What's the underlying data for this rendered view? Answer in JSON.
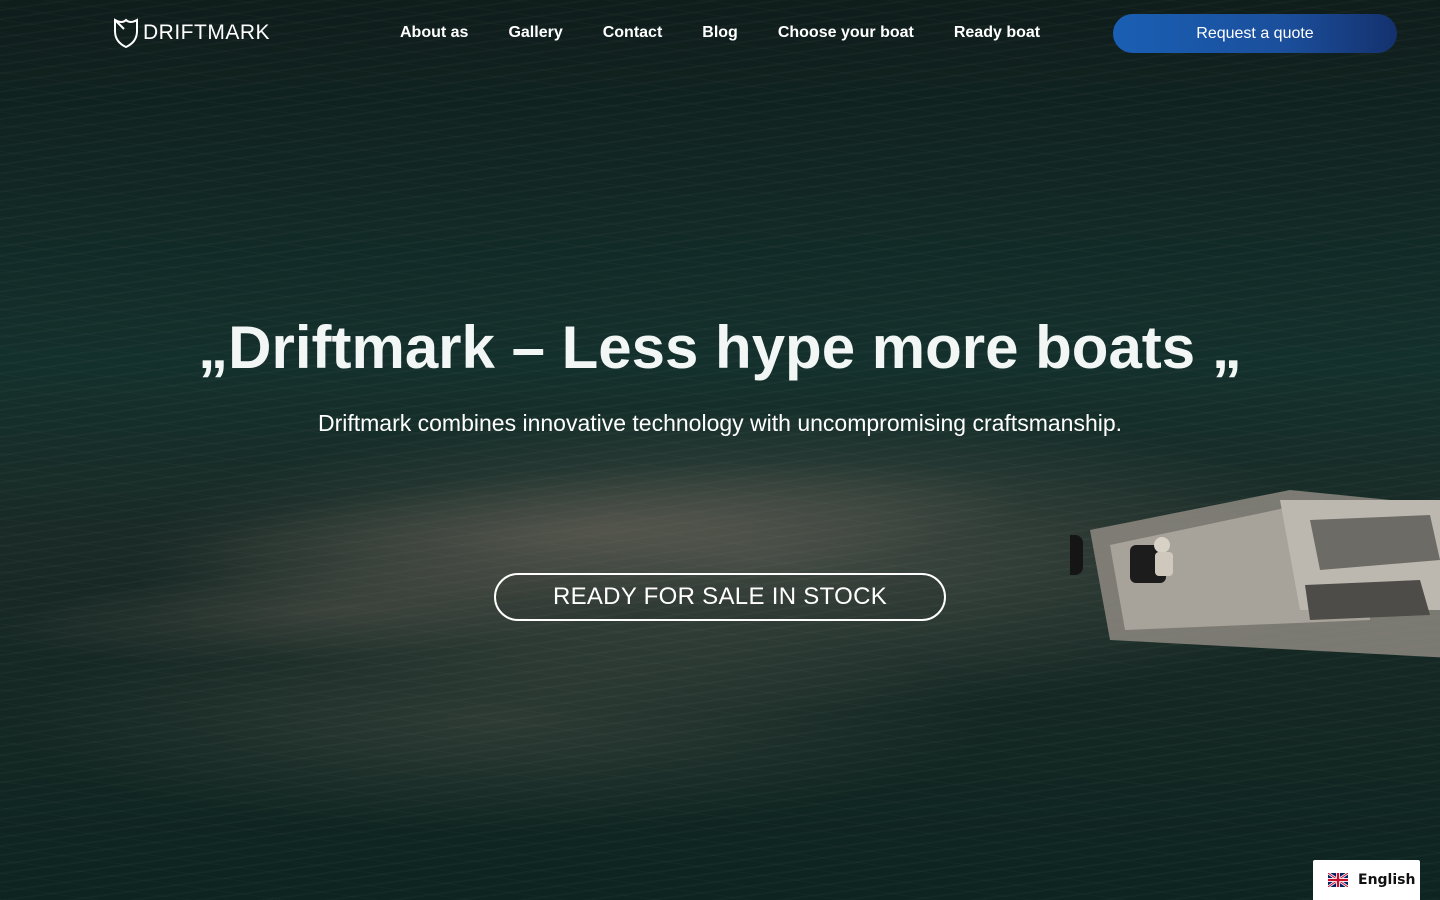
{
  "brand": {
    "name": "DRIFTMARK",
    "logo_icon": "shield-logo-icon"
  },
  "nav": {
    "items": [
      {
        "label": "About as"
      },
      {
        "label": "Gallery"
      },
      {
        "label": "Contact"
      },
      {
        "label": "Blog"
      },
      {
        "label": "Choose your boat"
      },
      {
        "label": "Ready boat"
      }
    ]
  },
  "header": {
    "quote_label": "Request a quote"
  },
  "hero": {
    "headline": "„Driftmark – Less hype more boats „",
    "subtitle": "Driftmark combines innovative technology with uncompromising craftsmanship.",
    "cta_label": "READY FOR SALE IN STOCK"
  },
  "language": {
    "label": "English",
    "flag_icon": "uk-flag-icon"
  },
  "colors": {
    "accent": "#1a5fb4",
    "accent_dark": "#14316e",
    "text": "#ffffff",
    "water": "#14302c"
  }
}
